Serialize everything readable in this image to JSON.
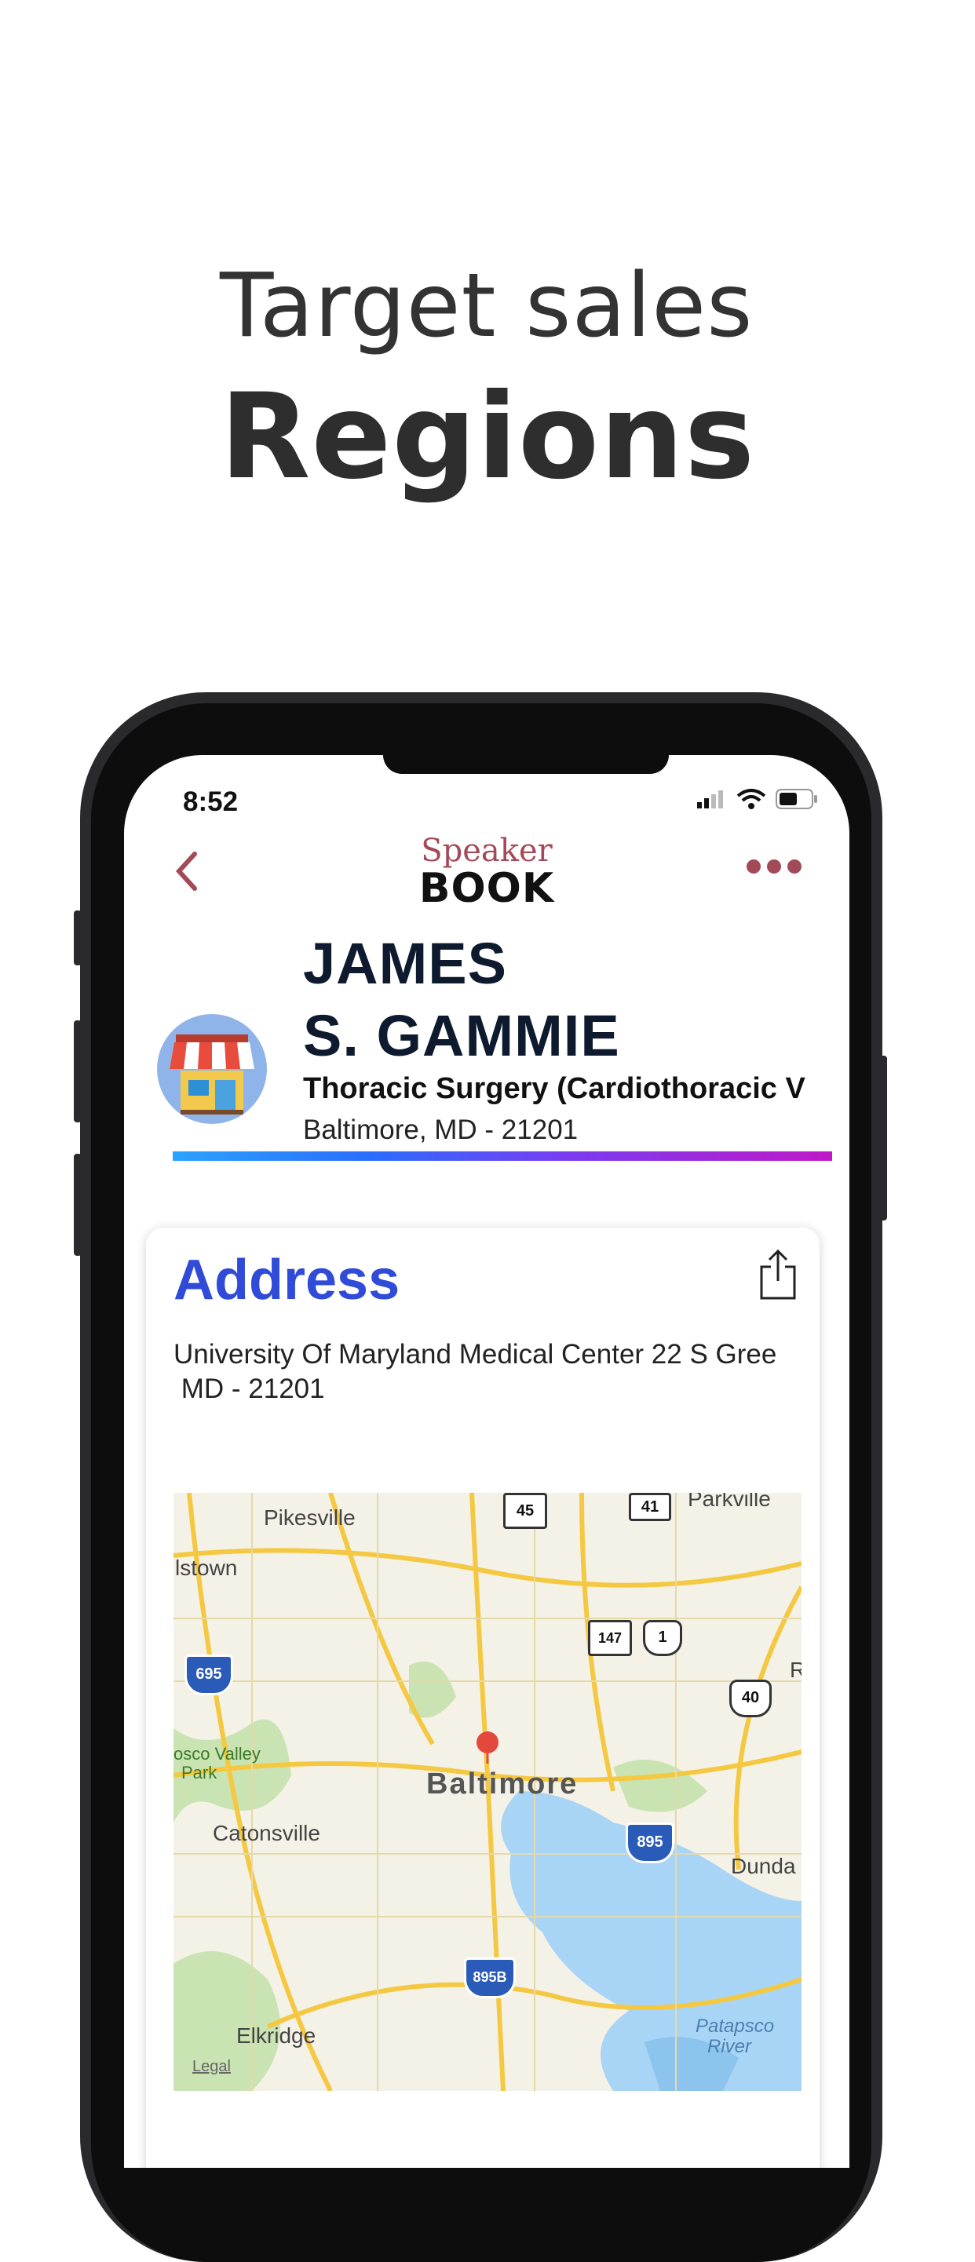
{
  "promo": {
    "line1": "Target sales",
    "line2": "Regions"
  },
  "status_bar": {
    "time": "8:52"
  },
  "nav": {
    "back_icon": "chevron-left-icon",
    "more_icon": "ellipsis-icon"
  },
  "logo": {
    "top": "Speaker",
    "bottom": "BOOK"
  },
  "profile": {
    "name_line1": "JAMES",
    "name_line2": "S. GAMMIE",
    "specialty": "Thoracic Surgery (Cardiothoracic V",
    "location": "Baltimore, MD - 21201",
    "avatar_icon": "storefront-icon"
  },
  "address_card": {
    "title": "Address",
    "address": "University Of Maryland Medical Center 22 S Gree\n MD - 21201",
    "share_icon": "share-icon"
  },
  "map": {
    "labels": {
      "pikesville": "Pikesville",
      "parkville": "Parkville",
      "lstown": "lstown",
      "baltimore": "Baltimore",
      "catonsville": "Catonsville",
      "dunda": "Dunda",
      "valley": "osco Valley",
      "park": "Park",
      "elkridge": "Elkridge",
      "patapsco": "Patapsco",
      "river": "River",
      "legal": "Legal",
      "r": "R"
    },
    "shields": {
      "i695": "695",
      "i895": "895",
      "i895b": "895B",
      "us40": "40",
      "us1": "1",
      "md45": "45",
      "md41": "41",
      "md147": "147"
    },
    "colors": {
      "land": "#f4f1e6",
      "water": "#a8d4f5",
      "park": "#c9e3b3",
      "highway": "#f5c842",
      "pin": "#e2483c"
    }
  }
}
